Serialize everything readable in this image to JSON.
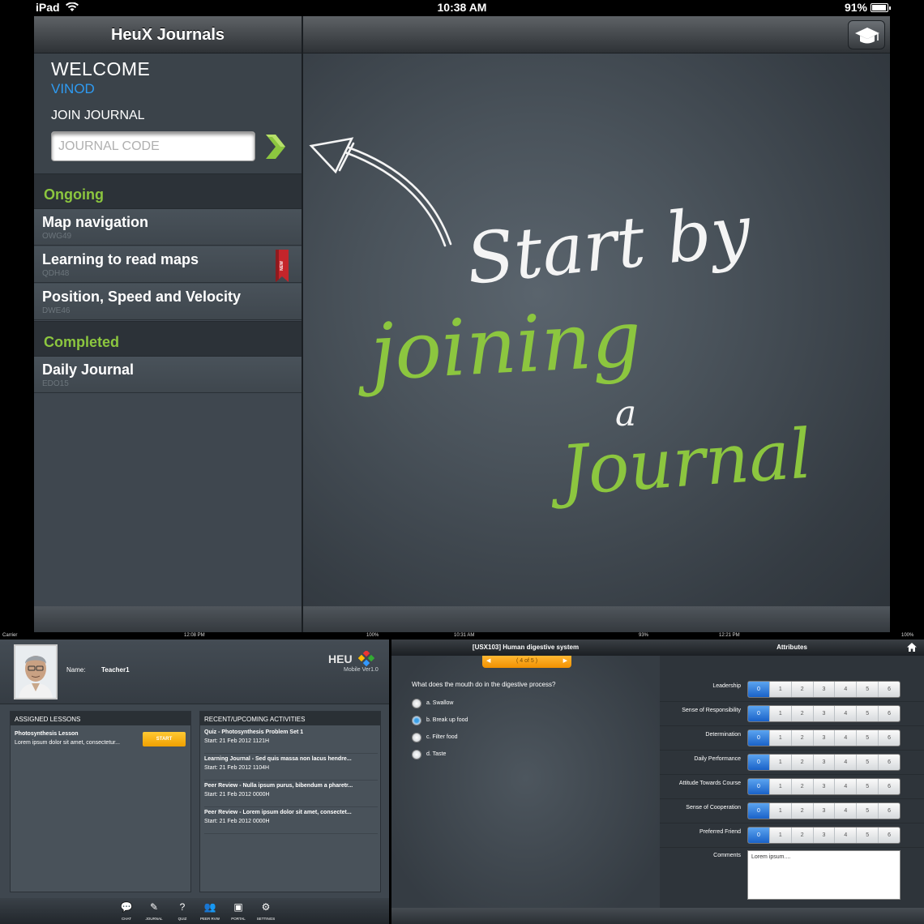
{
  "status_bar": {
    "carrier": "iPad",
    "time": "10:38 AM",
    "battery": "91%"
  },
  "sidebar": {
    "title": "HeuX Journals",
    "welcome": "WELCOME",
    "username": "VINOD",
    "join_label": "JOIN JOURNAL",
    "code_placeholder": "JOURNAL CODE",
    "ongoing_header": "Ongoing",
    "ongoing": [
      {
        "title": "Map navigation",
        "code": "OWG49"
      },
      {
        "title": "Learning to read maps",
        "code": "QDH48",
        "badge": "NEW"
      },
      {
        "title": "Position, Speed and Velocity",
        "code": "DWE46"
      }
    ],
    "completed_header": "Completed",
    "completed": [
      {
        "title": "Daily Journal",
        "code": "EDO15"
      }
    ]
  },
  "main": {
    "handwriting": {
      "line1": "Start by",
      "line2": "joining",
      "line3": "a",
      "line4": "Journal"
    },
    "colors": {
      "white": "#ffffff",
      "green": "#8cc63f",
      "accent_blue": "#2e9bf2"
    }
  },
  "shot1": {
    "status": {
      "carrier": "Carrier",
      "time": "12:08 PM",
      "battery": "100%"
    },
    "name_label": "Name:",
    "name_value": "Teacher1",
    "logo": "HEU",
    "version": "Mobile Ver1.0",
    "lessons_header": "ASSIGNED LESSONS",
    "lesson": {
      "title": "Photosynthesis Lesson",
      "desc": "Lorem ipsum dolor sit amet, consectetur...",
      "button": "START"
    },
    "activities_header": "RECENT/UPCOMING ACTIVITIES",
    "activities": [
      {
        "title": "Quiz - Photosynthesis Problem Set 1",
        "start": "Start: 21 Feb 2012 1121H"
      },
      {
        "title": "Learning Journal - Sed quis massa non lacus hendre...",
        "start": "Start: 21 Feb 2012 1104H"
      },
      {
        "title": "Peer Review - Nulla ipsum purus, bibendum a pharetr...",
        "start": "Start: 21 Feb 2012 0000H"
      },
      {
        "title": "Peer Review - Lorem ipsum dolor sit amet, consectet...",
        "start": "Start: 21 Feb 2012 0000H"
      }
    ],
    "tabs": [
      {
        "label": "CHAT",
        "icon": "chat-icon",
        "glyph": "💬"
      },
      {
        "label": "JOURNAL",
        "icon": "journal-icon",
        "glyph": "✎"
      },
      {
        "label": "QUIZ",
        "icon": "quiz-icon",
        "glyph": "?"
      },
      {
        "label": "PEER RVW",
        "icon": "peer-review-icon",
        "glyph": "👥"
      },
      {
        "label": "PORTAL",
        "icon": "portal-icon",
        "glyph": "▣"
      },
      {
        "label": "SETTINGS",
        "icon": "settings-icon",
        "glyph": "⚙"
      }
    ]
  },
  "shot2": {
    "status": {
      "time": "10:31 AM",
      "battery": "93%"
    },
    "title": "[USX103] Human digestive system",
    "pager": "( 4 of 5 )",
    "question": "What does the mouth do in the digestive process?",
    "options": [
      "a. Swallow",
      "b. Break up food",
      "c. Filter food",
      "d. Taste"
    ],
    "selected_index": 1
  },
  "shot3": {
    "status": {
      "time": "12:21 PM",
      "battery": "100%"
    },
    "title": "Attributes",
    "scale": [
      "0",
      "1",
      "2",
      "3",
      "4",
      "5",
      "6"
    ],
    "attributes": [
      "Leadership",
      "Sense of Responsibility",
      "Determination",
      "Daily Performance",
      "Attitude Towards Course",
      "Sense of Cooperation",
      "Preferred Friend"
    ],
    "selected_value": 0,
    "comments_label": "Comments",
    "comments_value": "Lorem ipsum...."
  }
}
